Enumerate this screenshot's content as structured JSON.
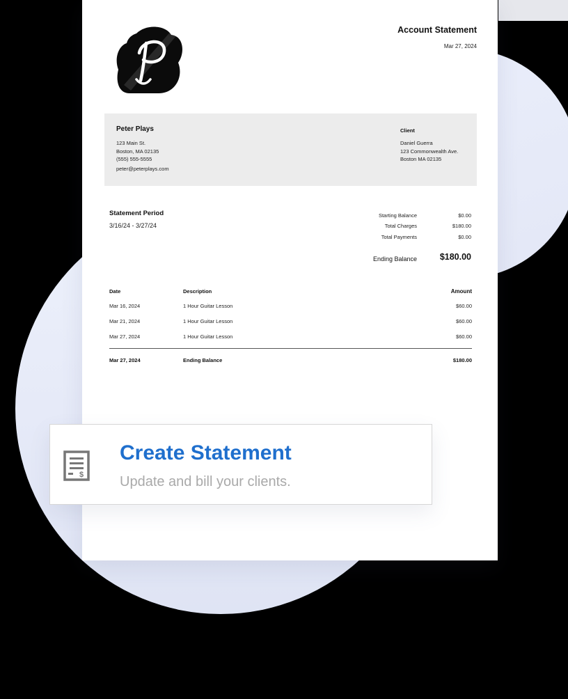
{
  "document": {
    "title": "Account Statement",
    "date": "Mar 27, 2024",
    "logo_letter": "P",
    "company": {
      "name": "Peter Plays",
      "street": "123 Main St.",
      "city": "Boston, MA 02135",
      "phone": "(555) 555-5555",
      "email": "peter@peterplays.com"
    },
    "client": {
      "label": "Client",
      "name": "Daniel Guerra",
      "street": "123 Commonwealth Ave.",
      "city": "Boston MA 02135"
    },
    "period": {
      "label": "Statement Period",
      "value": "3/16/24 - 3/27/24"
    },
    "summary": [
      {
        "label": "Starting Balance",
        "value": "$0.00"
      },
      {
        "label": "Total Charges",
        "value": "$180.00"
      },
      {
        "label": "Total Payments",
        "value": "$0.00"
      }
    ],
    "ending": {
      "label": "Ending Balance",
      "value": "$180.00"
    },
    "table": {
      "headers": {
        "date": "Date",
        "description": "Description",
        "amount": "Amount"
      },
      "rows": [
        {
          "date": "Mar 16, 2024",
          "description": "1 Hour Guitar Lesson",
          "amount": "$60.00"
        },
        {
          "date": "Mar 21, 2024",
          "description": "1 Hour Guitar Lesson",
          "amount": "$60.00"
        },
        {
          "date": "Mar 27, 2024",
          "description": "1 Hour Guitar Lesson",
          "amount": "$60.00"
        }
      ],
      "total": {
        "date": "Mar 27, 2024",
        "description": "Ending Balance",
        "amount": "$180.00"
      }
    }
  },
  "feature_card": {
    "icon": "statement-icon",
    "title": "Create Statement",
    "subtitle": "Update and bill your clients."
  },
  "colors": {
    "accent": "#1f6fcd",
    "subtitle": "#a9a9a9",
    "band": "#ececec",
    "background_blob": "#e6eaf8"
  }
}
